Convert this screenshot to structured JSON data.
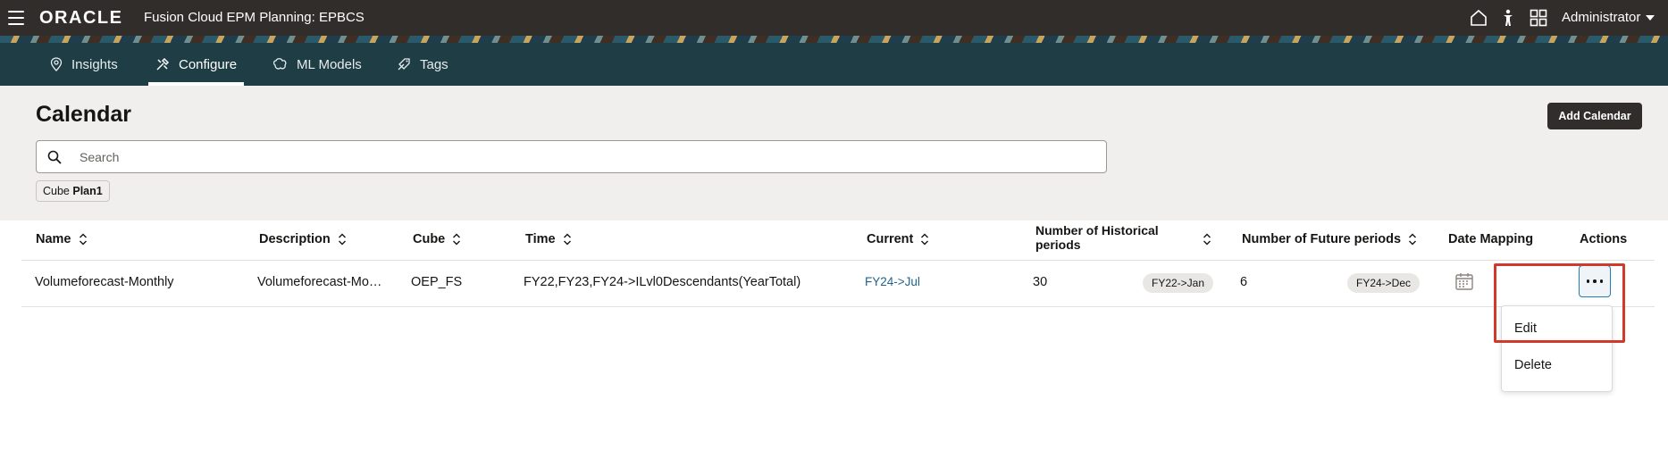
{
  "topbar": {
    "logo": "ORACLE",
    "app_title": "Fusion Cloud EPM Planning:  EPBCS",
    "user": "Administrator",
    "icons": [
      "menu-icon",
      "home-icon",
      "accessibility-icon",
      "navigator-grid-icon"
    ]
  },
  "nav": {
    "tabs": [
      {
        "label": "Insights",
        "icon": "location-pin-icon",
        "active": false
      },
      {
        "label": "Configure",
        "icon": "tools-icon",
        "active": true
      },
      {
        "label": "ML Models",
        "icon": "ml-models-icon",
        "active": false
      },
      {
        "label": "Tags",
        "icon": "tag-icon",
        "active": false
      }
    ]
  },
  "page": {
    "title": "Calendar",
    "add_button": "Add Calendar",
    "search_placeholder": "Search",
    "filter_chip": {
      "label": "Cube",
      "value": "Plan1"
    }
  },
  "table": {
    "headers": {
      "name": "Name",
      "description": "Description",
      "cube": "Cube",
      "time": "Time",
      "current": "Current",
      "hist_line1": "Number of Historical",
      "hist_line2": "periods",
      "future": "Number of Future periods",
      "date_mapping": "Date Mapping",
      "actions": "Actions"
    },
    "rows": [
      {
        "name": "Volumeforecast-Monthly",
        "description": "Volumeforecast-Mo…",
        "cube": "OEP_FS",
        "time": "FY22,FY23,FY24->ILvl0Descendants(YearTotal)",
        "current": "FY24->Jul",
        "historical_count": "30",
        "historical_start": "FY22->Jan",
        "future_count": "6",
        "future_end": "FY24->Dec"
      }
    ]
  },
  "actions_menu": {
    "items": [
      "Edit",
      "Delete"
    ]
  },
  "colors": {
    "topbar": "#312d2a",
    "navbar": "#1f3d44",
    "header_bg": "#f1efed",
    "link": "#22648c",
    "highlight": "#d0392b"
  }
}
